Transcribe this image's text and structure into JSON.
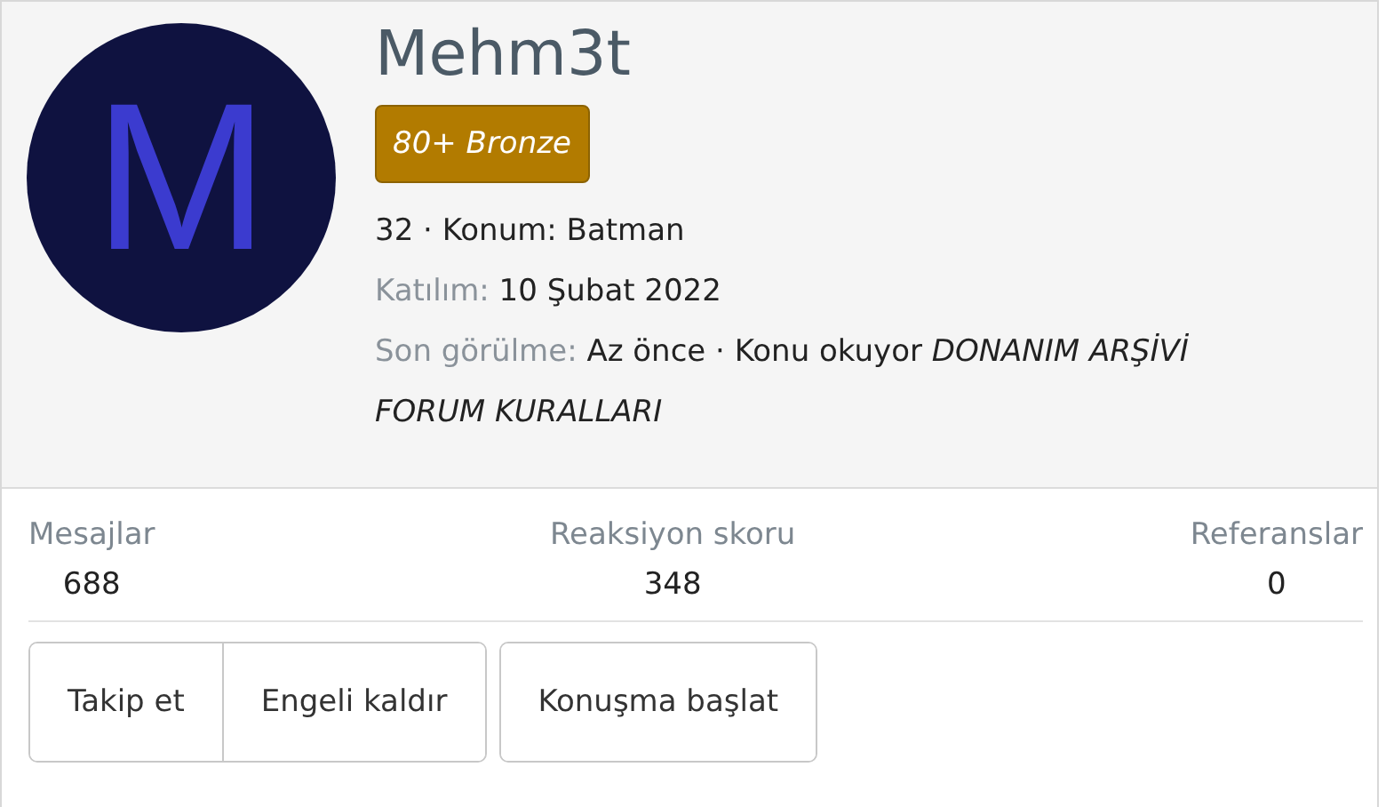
{
  "profile": {
    "avatar_letter": "M",
    "username": "Mehm3t",
    "badge": "80+ Bronze",
    "info_line": "32 · Konum: Batman",
    "joined": {
      "label": "Katılım:",
      "value": "10 Şubat 2022"
    },
    "last_seen": {
      "label": "Son görülme:",
      "value": "Az önce · Konu okuyor *DONANIM ARŞİVİ FORUM KURALLARI*"
    }
  },
  "stats": [
    {
      "label": "Mesajlar",
      "value": "688"
    },
    {
      "label": "Reaksiyon skoru",
      "value": "348"
    },
    {
      "label": "Referanslar",
      "value": "0"
    }
  ],
  "button_groups": [
    [
      "Takip et",
      "Engeli kaldır"
    ],
    [
      "Konuşma başlat"
    ]
  ]
}
